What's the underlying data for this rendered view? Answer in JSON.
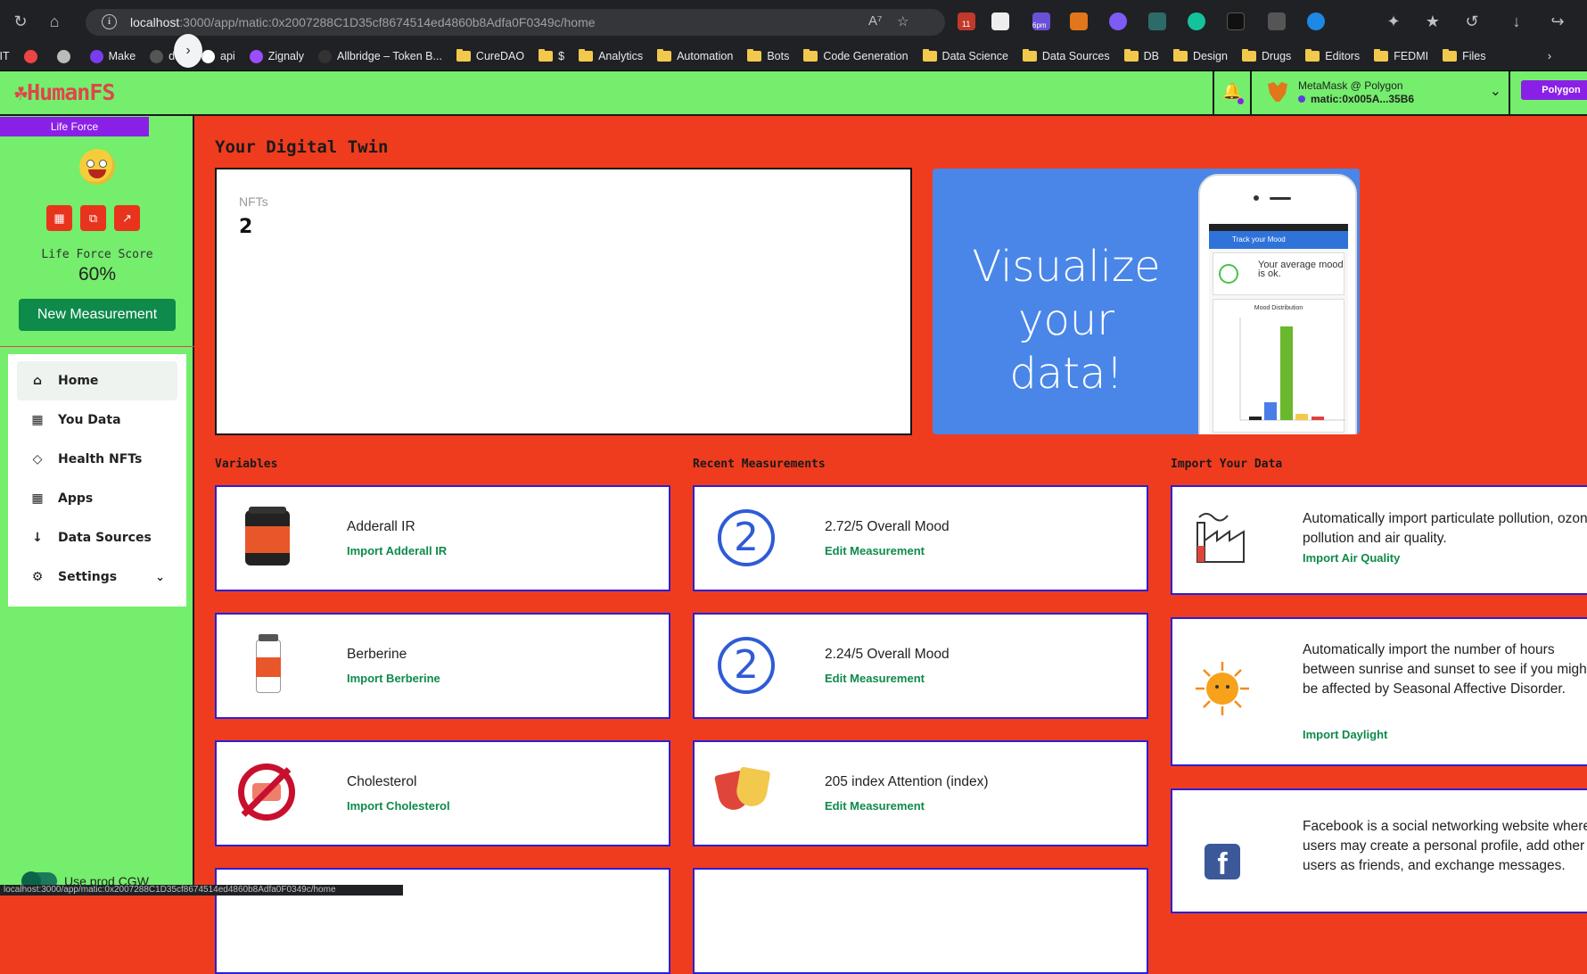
{
  "browser": {
    "url_host": "localhost",
    "url_path": ":3000/app/matic:0x2007288C1D35cf8674514ed4860b8Adfa0F0349c/home",
    "status_url": "localhost:3000/app/matic:0x2007288C1D35cf8674514ed4860b8Adfa0F0349c/home",
    "badge_11": "11",
    "badge_6pm": "6pm",
    "bookmarks": [
      {
        "label": "IIT",
        "type": "text"
      },
      {
        "label": "",
        "type": "icon",
        "color": "#e44"
      },
      {
        "label": "",
        "type": "icon",
        "color": "#bbb"
      },
      {
        "label": "Make",
        "type": "icon",
        "color": "#7a3cf0"
      },
      {
        "label": "dao",
        "type": "icon",
        "color": "#555"
      },
      {
        "label": "api",
        "type": "icon",
        "color": "#fff"
      },
      {
        "label": "Zignaly",
        "type": "icon",
        "color": "#9b4dff"
      },
      {
        "label": "Allbridge – Token B...",
        "type": "icon",
        "color": "#333"
      },
      {
        "label": "CureDAO",
        "type": "folder"
      },
      {
        "label": "$",
        "type": "folder"
      },
      {
        "label": "Analytics",
        "type": "folder"
      },
      {
        "label": "Automation",
        "type": "folder"
      },
      {
        "label": "Bots",
        "type": "folder"
      },
      {
        "label": "Code Generation",
        "type": "folder"
      },
      {
        "label": "Data Science",
        "type": "folder"
      },
      {
        "label": "Data Sources",
        "type": "folder"
      },
      {
        "label": "DB",
        "type": "folder"
      },
      {
        "label": "Design",
        "type": "folder"
      },
      {
        "label": "Drugs",
        "type": "folder"
      },
      {
        "label": "Editors",
        "type": "folder"
      },
      {
        "label": "FEDMI",
        "type": "folder"
      },
      {
        "label": "Files",
        "type": "folder"
      }
    ]
  },
  "header": {
    "logo": "HumanFS",
    "wallet_line1": "MetaMask @ Polygon",
    "wallet_line2": "matic:0x005A...35B6",
    "network_button": "Polygon"
  },
  "sidebar": {
    "life_force_tab": "Life Force",
    "score_label": "Life Force Score",
    "score_value": "60%",
    "new_measurement": "New Measurement",
    "nav": [
      {
        "label": "Home",
        "icon": "home-icon"
      },
      {
        "label": "You Data",
        "icon": "grid-icon"
      },
      {
        "label": "Health NFTs",
        "icon": "diamond-icon"
      },
      {
        "label": "Apps",
        "icon": "grid-icon"
      },
      {
        "label": "Data Sources",
        "icon": "arrow-down-icon"
      },
      {
        "label": "Settings",
        "icon": "gear-icon"
      }
    ],
    "toggle_label": "Use prod CGW"
  },
  "main": {
    "title": "Your Digital Twin",
    "nfts_label": "NFTs",
    "nfts_value": "2",
    "promo_text": "Visualize your data!",
    "phone_bar": "Track your Mood",
    "phone_mood": "Your average mood is ok.",
    "phone_chart_title": "Mood Distribution"
  },
  "variables": {
    "title": "Variables",
    "items": [
      {
        "name": "Adderall IR",
        "action": "Import Adderall IR"
      },
      {
        "name": "Berberine",
        "action": "Import Berberine"
      },
      {
        "name": "Cholesterol",
        "action": "Import Cholesterol"
      }
    ]
  },
  "measurements": {
    "title": "Recent Measurements",
    "items": [
      {
        "name": "2.72/5 Overall Mood",
        "action": "Edit Measurement",
        "badge": "2"
      },
      {
        "name": "2.24/5 Overall Mood",
        "action": "Edit Measurement",
        "badge": "2"
      },
      {
        "name": "205 index Attention (index)",
        "action": "Edit Measurement"
      }
    ]
  },
  "imports": {
    "title": "Import Your Data",
    "items": [
      {
        "desc": "Automatically import particulate pollution, ozone pollution and air quality.",
        "action": "Import Air Quality"
      },
      {
        "desc": "Automatically import the number of hours between sunrise and sunset to see if you might be affected by Seasonal Affective Disorder.",
        "action": "Import Daylight"
      },
      {
        "desc": "Facebook is a social networking website where users may create a personal profile, add other users as friends, and exchange messages."
      }
    ]
  },
  "colors": {
    "page_bg": "#f03c1e",
    "header_green": "#74ee6c",
    "accent_purple": "#8a20e8",
    "action_green": "#0e8a4a",
    "card_border": "#2a1fd6"
  }
}
